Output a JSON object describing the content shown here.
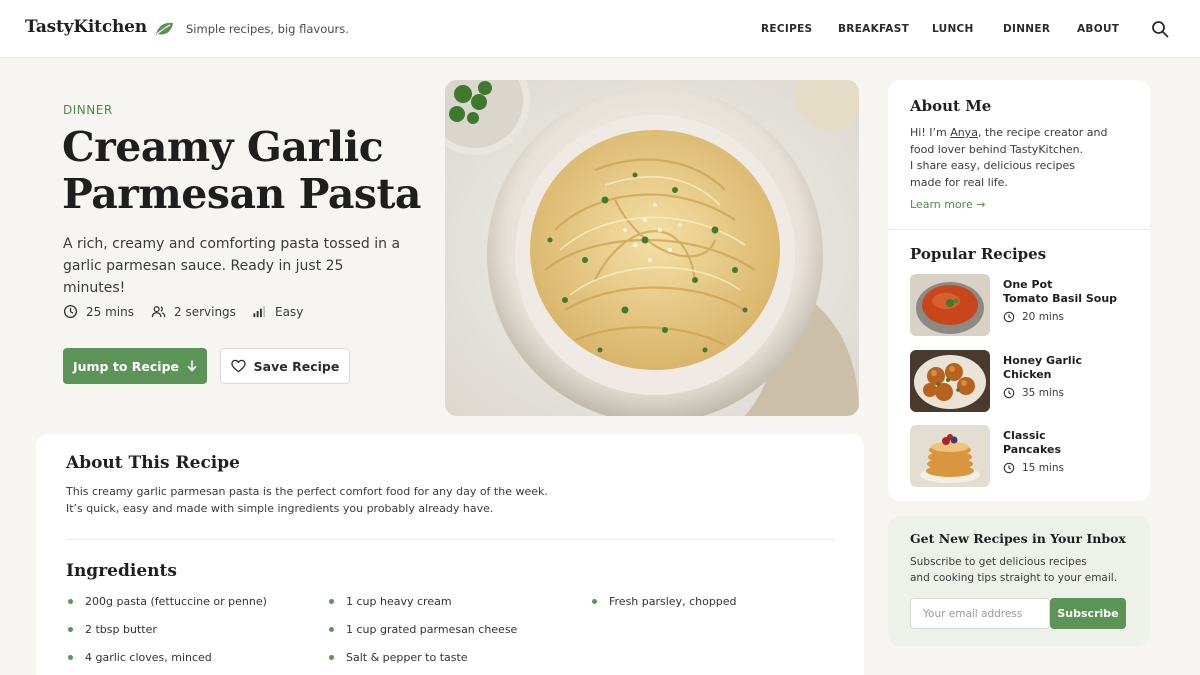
{
  "header": {
    "logo": "TastyKitchen",
    "tagline": "Simple recipes, big flavours.",
    "nav": [
      "RECIPES",
      "BREAKFAST",
      "LUNCH",
      "DINNER",
      "ABOUT"
    ],
    "icons": {
      "leaf": "leaf-icon",
      "search": "search-icon"
    }
  },
  "hero": {
    "category": "DINNER",
    "title_line1": "Creamy Garlic",
    "title_line2": "Parmesan Pasta",
    "description": "A rich, creamy and comforting pasta tossed in a garlic parmesan sauce. Ready in just 25 minutes!",
    "time": "25 mins",
    "servings": "2 servings",
    "difficulty": "Easy",
    "jump_button": "Jump to Recipe",
    "save_button": "Save Recipe",
    "image": "creamy-garlic-parmesan-pasta-photo"
  },
  "about_recipe": {
    "heading": "About This Recipe",
    "text_line1": "This creamy garlic parmesan pasta is the perfect comfort food for any day of the week.",
    "text_line2": "It’s quick, easy and made with simple ingredients you probably already have."
  },
  "ingredients": {
    "heading": "Ingredients",
    "items": [
      "200g pasta (fettuccine or penne)",
      "2 tbsp butter",
      "4 garlic cloves, minced",
      "1 cup heavy cream",
      "1 cup grated parmesan cheese",
      "Salt & pepper to taste",
      "Fresh parsley, chopped"
    ]
  },
  "sidebar": {
    "about_heading": "About Me",
    "about_pre": "Hi! I’m ",
    "about_name": "Anya",
    "about_post": ", the recipe creator and",
    "about_line2": "food lover behind TastyKitchen.",
    "about_line3": "I share easy, delicious recipes",
    "about_line4": "made for real life.",
    "learn_more": "Learn more →",
    "popular_heading": "Popular Recipes",
    "popular": [
      {
        "title_line1": "One Pot",
        "title_line2": "Tomato Basil Soup",
        "time": "20 mins"
      },
      {
        "title_line1": "Honey Garlic",
        "title_line2": "Chicken",
        "time": "35 mins"
      },
      {
        "title_line1": "Classic",
        "title_line2": "Pancakes",
        "time": "15 mins"
      }
    ]
  },
  "newsletter": {
    "heading": "Get New Recipes in Your Inbox",
    "text_line1": "Subscribe to get delicious recipes",
    "text_line2": "and cooking tips straight to your email.",
    "placeholder": "Your email address",
    "button": "Subscribe"
  },
  "colors": {
    "accent": "#5c9357",
    "background": "#f6f5f2",
    "card": "#ffffff",
    "newsletter_bg": "#eef1ea"
  }
}
